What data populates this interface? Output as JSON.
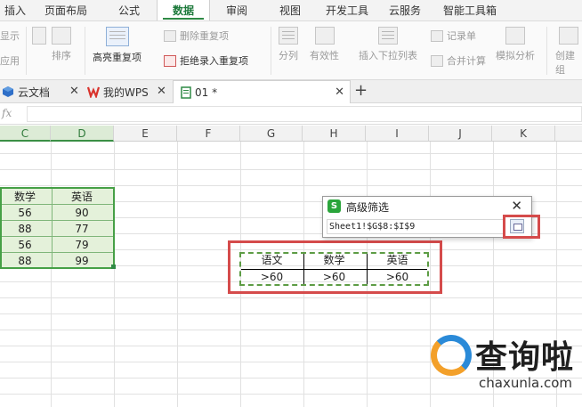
{
  "menu_tabs": [
    "插入",
    "页面布局",
    "公式",
    "数据",
    "审阅",
    "视图",
    "开发工具",
    "云服务",
    "智能工具箱"
  ],
  "ribbon": {
    "show_partial": "显示",
    "apply_partial": "应用",
    "sort": "排序",
    "highlight_dup": "高亮重复项",
    "delete_dup": "删除重复项",
    "reject_dup": "拒绝录入重复项",
    "split": "分列",
    "validity": "有效性",
    "insert_dropdown": "插入下拉列表",
    "record_form": "记录单",
    "consolidate": "合并计算",
    "simulate": "模拟分析",
    "create_partial": "创建组"
  },
  "doc_tabs": {
    "cloud_docs": "云文档",
    "my_wps": "我的WPS",
    "file": "01 *",
    "add": "+"
  },
  "formula_bar": {
    "fx": "fx"
  },
  "columns": [
    "C",
    "D",
    "E",
    "F",
    "G",
    "H",
    "I",
    "J",
    "K"
  ],
  "table": {
    "headers": [
      "数学",
      "英语"
    ],
    "rows": [
      [
        "56",
        "90"
      ],
      [
        "88",
        "77"
      ],
      [
        "56",
        "79"
      ],
      [
        "88",
        "99"
      ]
    ]
  },
  "criteria": {
    "headers": [
      "语文",
      "数学",
      "英语"
    ],
    "values": [
      ">60",
      ">60",
      ">60"
    ]
  },
  "dialog": {
    "logo": "S",
    "title": "高级筛选",
    "close": "✕",
    "range": "Sheet1!$G$8:$I$9"
  },
  "watermark": {
    "title": "查询啦",
    "url": "chaxunla.com"
  },
  "colors": {
    "accent": "#2f8a45",
    "highlight_red": "#d54b4b",
    "table_fill": "#e4f1da"
  }
}
